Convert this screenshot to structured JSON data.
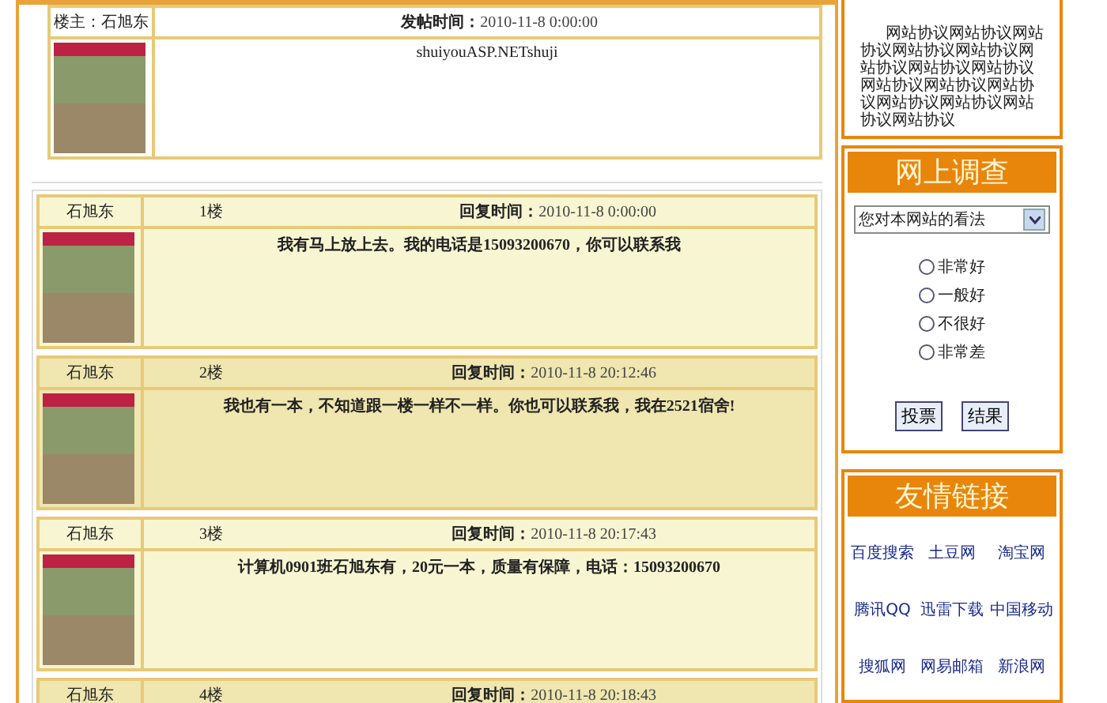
{
  "topic": {
    "author_label": "楼主：石旭东",
    "time_label": "发帖时间：",
    "time": "2010-11-8 0:00:00",
    "content": "shuiyouASP.NETshuji"
  },
  "replies": [
    {
      "author": "石旭东",
      "floor": "1楼",
      "time_label": "回复时间：",
      "time": "2010-11-8 0:00:00",
      "content": "我有马上放上去。我的电话是15093200670，你可以联系我"
    },
    {
      "author": "石旭东",
      "floor": "2楼",
      "time_label": "回复时间：",
      "time": "2010-11-8 20:12:46",
      "content": "我也有一本，不知道跟一楼一样不一样。你也可以联系我，我在2521宿舍!"
    },
    {
      "author": "石旭东",
      "floor": "3楼",
      "time_label": "回复时间：",
      "time": "2010-11-8 20:17:43",
      "content": "计算机0901班石旭东有，20元一本，质量有保障，电话：15093200670"
    },
    {
      "author": "石旭东",
      "floor": "4楼",
      "time_label": "回复时间：",
      "time": "2010-11-8 20:18:43"
    }
  ],
  "sidebar": {
    "notice": "网站协议网站协议网站协议网站协议网站协议网站协议网站协议网站协议网站协议网站协议网站协议网站协议网站协议网站协议网站协议",
    "survey": {
      "title": "网上调查",
      "select": "您对本网站的看法",
      "options": [
        {
          "label": "非常好",
          "selected": false
        },
        {
          "label": "一般好",
          "selected": false
        },
        {
          "label": "不很好",
          "selected": false
        },
        {
          "label": "非常差",
          "selected": false
        }
      ],
      "buttons": [
        "投票",
        "结果"
      ]
    },
    "links": {
      "title": "友情链接",
      "items": [
        "百度搜索",
        "土豆网",
        "淘宝网",
        "腾讯QQ",
        "迅雷下载",
        "中国移动",
        "搜狐网",
        "网易邮箱",
        "新浪网"
      ]
    }
  }
}
